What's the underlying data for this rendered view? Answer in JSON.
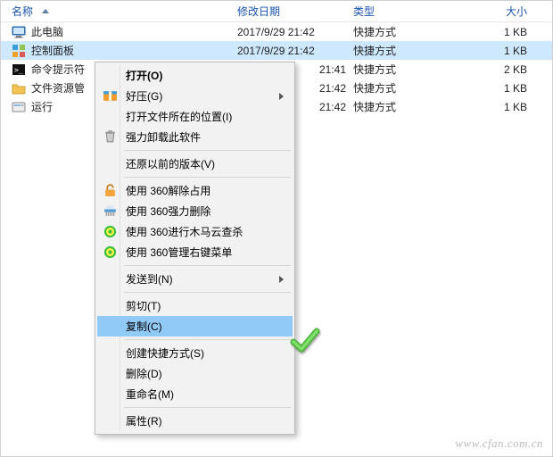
{
  "columns": {
    "name": "名称",
    "date": "修改日期",
    "type": "类型",
    "size": "大小"
  },
  "files": [
    {
      "icon": "pc-icon",
      "name": "此电脑",
      "date": "2017/9/29 21:42",
      "type": "快捷方式",
      "size": "1 KB",
      "selected": false
    },
    {
      "icon": "panel-icon",
      "name": "控制面板",
      "date": "2017/9/29 21:42",
      "type": "快捷方式",
      "size": "1 KB",
      "selected": true
    },
    {
      "icon": "cmd-icon",
      "name": "命令提示符",
      "date": "",
      "type": "快捷方式",
      "size": "2 KB",
      "selected": false,
      "dateTail": "21:41"
    },
    {
      "icon": "explorer-icon",
      "name": "文件资源管",
      "date": "",
      "type": "快捷方式",
      "size": "1 KB",
      "selected": false,
      "dateTail": "21:42"
    },
    {
      "icon": "run-icon",
      "name": "运行",
      "date": "",
      "type": "快捷方式",
      "size": "1 KB",
      "selected": false,
      "dateTail": "21:42"
    }
  ],
  "menu": {
    "open": "打开(O)",
    "haozip": "好压(G)",
    "openloc": "打开文件所在的位置(I)",
    "uninstall": "强力卸载此软件",
    "restore": "还原以前的版本(V)",
    "rel360": "使用 360解除占用",
    "del360": "使用 360强力删除",
    "scan360": "使用 360进行木马云查杀",
    "mgr360": "使用 360管理右键菜单",
    "sendto": "发送到(N)",
    "cut": "剪切(T)",
    "copy": "复制(C)",
    "shortcut": "创建快捷方式(S)",
    "delete": "删除(D)",
    "rename": "重命名(M)",
    "props": "属性(R)"
  },
  "watermark": "www.cfan.com.cn"
}
